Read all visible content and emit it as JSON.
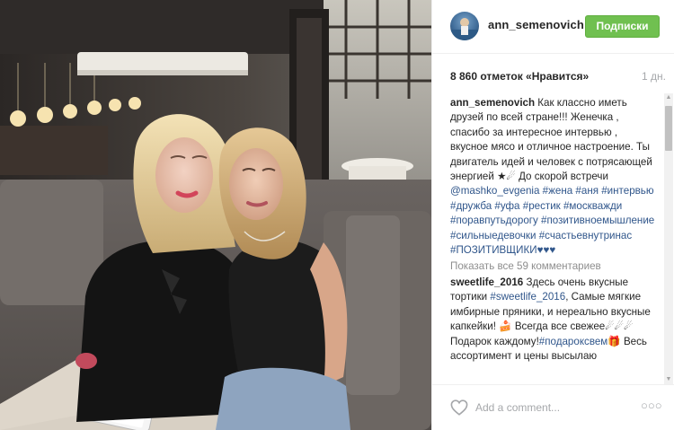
{
  "post": {
    "username": "ann_semenovich",
    "follow_label": "Подписки",
    "likes": "8 860 отметок «Нравится»",
    "age": "1 дн.",
    "more_comments": "Показать все 59 комментариев",
    "add_comment_placeholder": "Add a comment...",
    "options_glyph": "○○○"
  },
  "caption": {
    "author": "ann_semenovich",
    "text": " Как классно иметь друзей по всей стране!!! Женечка , спасибо за интересное интервью , вкусное мясо и отличное настроение. Ты двигатель идей и человек с потрясающей энергией ★☄ До скорой встречи",
    "mention": "@mashko_evgenia",
    "hashtags": [
      "#жена",
      "#аня",
      "#интервью",
      "#дружба",
      "#уфа",
      "#рестик",
      "#москважди",
      "#поравпутьдорогу",
      "#позитивноемышление",
      "#сильныедевочки",
      "#счастьевнутринас",
      "#ПОЗИТИВЩИКИ♥♥♥"
    ]
  },
  "comment": {
    "author": "sweetlife_2016",
    "text1": " Здесь очень  вкусные тортики ",
    "tag1": "#sweetlife_2016",
    "text2": ",  Самые мягкие имбирные пряники, и нереально вкусные капкейки! 🍰 Всегда все свежее☄☄☄ Подарок каждому!",
    "tag2": "#подароксвем",
    "text3": "🎁 Весь ассортимент и цены высылаю"
  },
  "colors": {
    "follow_button": "#70c050",
    "hashtag": "#30568b",
    "muted": "#a5a7aa"
  }
}
